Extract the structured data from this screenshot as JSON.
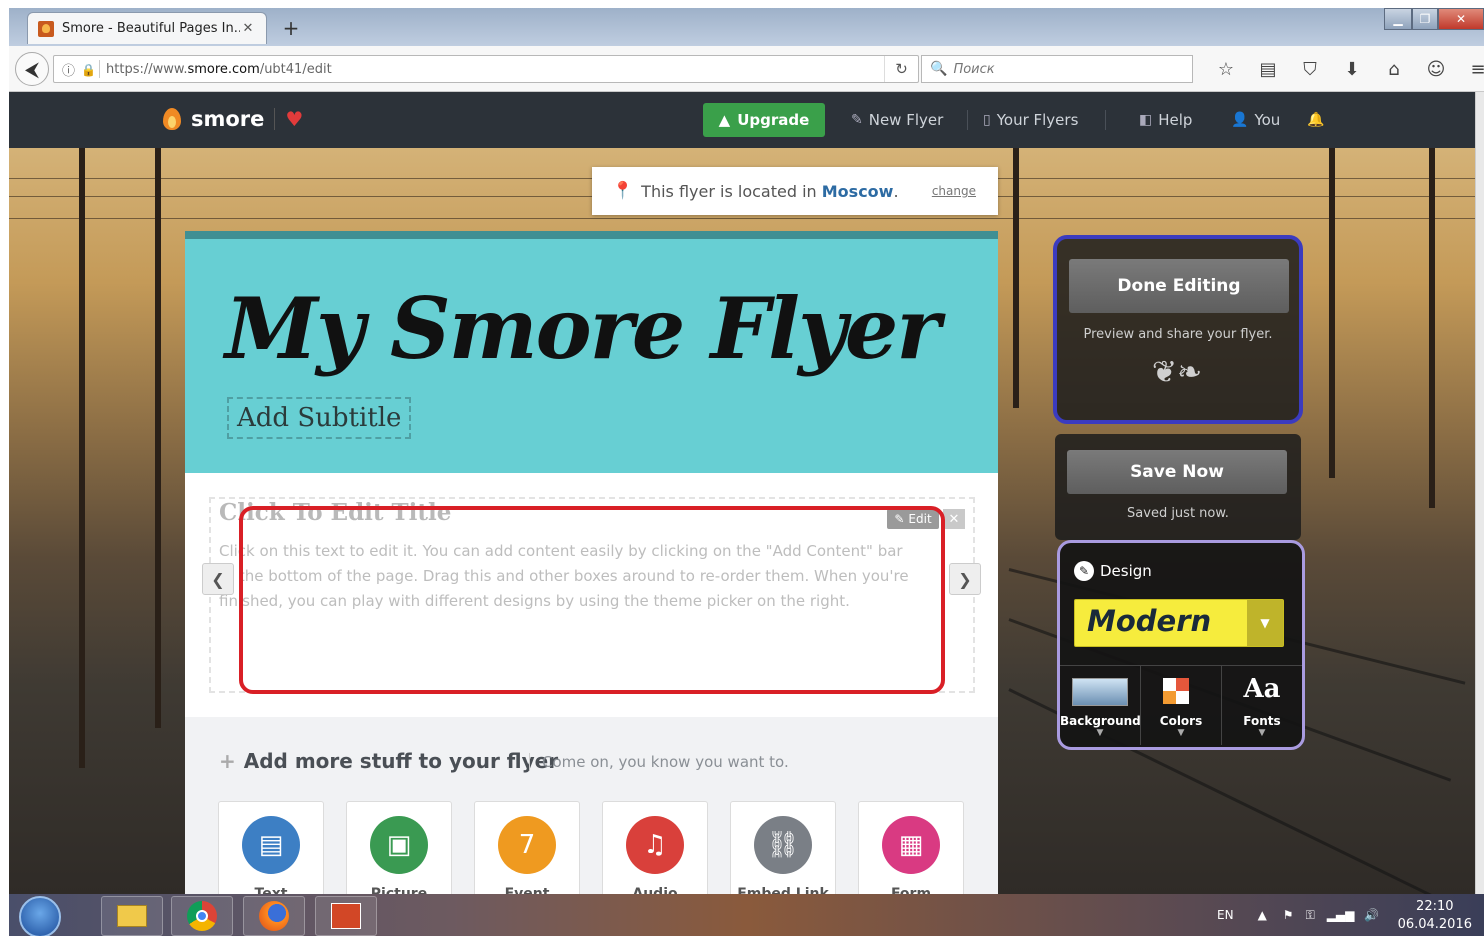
{
  "browser": {
    "tab_title": "Smore - Beautiful Pages In...",
    "url_prefix": "https://www.",
    "url_domain": "smore.com",
    "url_path": "/ubt41/edit",
    "search_placeholder": "Поиск"
  },
  "header": {
    "logo": "smore",
    "upgrade": "Upgrade",
    "nav": [
      "New Flyer",
      "Your Flyers",
      "Help",
      "You"
    ]
  },
  "location": {
    "prefix": "This flyer is located in ",
    "city": "Moscow",
    "suffix": ".",
    "change": "change"
  },
  "flyer": {
    "title": "My Smore Flyer",
    "subtitle": "Add Subtitle",
    "block": {
      "title": "Click To Edit Title",
      "text": "Click on this text to edit it. You can add content easily by clicking on the \"Add Content\" bar at the bottom of the page. Drag this and other boxes around to re-order them. When you're finished, you can play with different designs by using the theme picker on the right.",
      "edit": "Edit"
    },
    "add_more": {
      "title": "Add more stuff to your flyer",
      "subtitle": "Come on, you know you want to.",
      "items": [
        {
          "label": "Text",
          "color": "#3d7fc4"
        },
        {
          "label": "Picture",
          "color": "#3a9a52"
        },
        {
          "label": "Event",
          "color": "#ef9a20"
        },
        {
          "label": "Audio",
          "color": "#d9403b"
        },
        {
          "label": "Embed Link",
          "color": "#7a7f86"
        },
        {
          "label": "Form",
          "color": "#d93a82"
        }
      ]
    }
  },
  "panel": {
    "done": "Done Editing",
    "done_note": "Preview and share your flyer.",
    "save": "Save Now",
    "save_note": "Saved just now.",
    "design_label": "Design",
    "theme": "Modern",
    "tools": [
      "Background",
      "Colors",
      "Fonts"
    ]
  },
  "taskbar": {
    "lang": "EN",
    "time": "22:10",
    "date": "06.04.2016"
  }
}
